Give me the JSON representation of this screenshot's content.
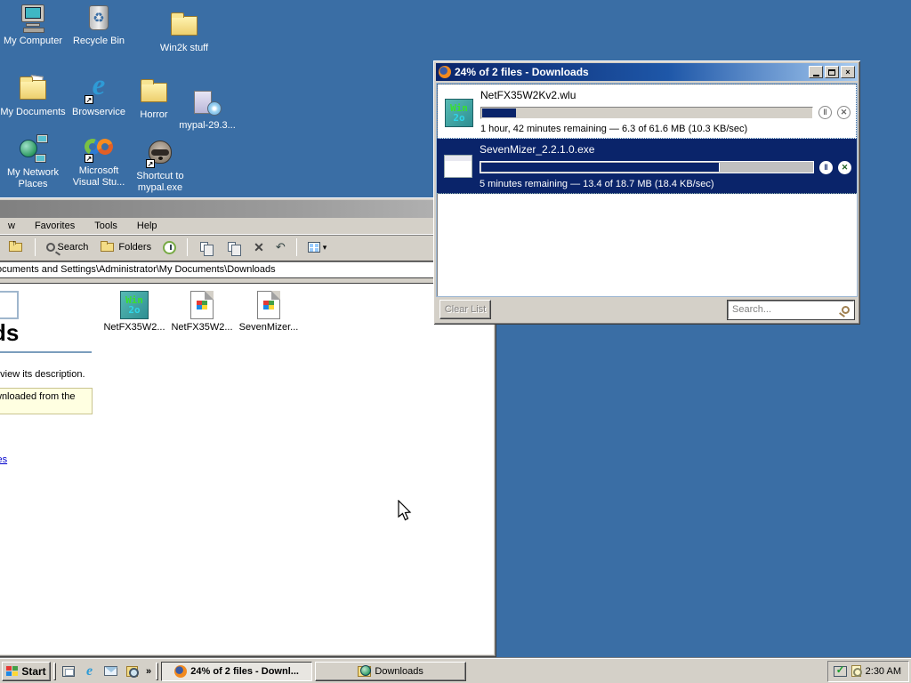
{
  "desktop": {
    "icons": [
      {
        "label": "My Computer"
      },
      {
        "label": "Recycle Bin"
      },
      {
        "label": "Win2k stuff"
      },
      {
        "label": "My Documents"
      },
      {
        "label": "Browservice"
      },
      {
        "label": "Horror"
      },
      {
        "label": "mypal-29.3..."
      },
      {
        "label": "My Network Places"
      },
      {
        "label": "Microsoft Visual Stu..."
      },
      {
        "label": "Shortcut to mypal.exe"
      }
    ]
  },
  "downloads_window": {
    "title": "24% of 2 files - Downloads",
    "items": [
      {
        "name": "NetFX35W2Kv2.wlu",
        "status": "1 hour, 42 minutes remaining — 6.3 of 61.6 MB (10.3 KB/sec)",
        "progress_percent": 10.2
      },
      {
        "name": "SevenMizer_2.2.1.0.exe",
        "status": "5 minutes remaining — 13.4 of 18.7 MB (18.4 KB/sec)",
        "progress_percent": 71.7
      }
    ],
    "clear_list_label": "Clear List",
    "search_placeholder": "Search...",
    "icon1_line1": "Win",
    "icon1_line2": "2o",
    "colors": {
      "selection": "#0A246A",
      "progress_fill": "#0A246A"
    }
  },
  "explorer_window": {
    "menu_items": {
      "m0": "w",
      "m1": "Favorites",
      "m2": "Tools",
      "m3": "Help"
    },
    "toolbar": {
      "search_label": "Search",
      "folders_label": "Folders"
    },
    "address": "ocuments and Settings\\Administrator\\My Documents\\Downloads",
    "files": [
      {
        "label": "NetFX35W2..."
      },
      {
        "label": "NetFX35W2..."
      },
      {
        "label": "SevenMizer..."
      }
    ],
    "panel": {
      "title_fragment": "ds",
      "description_fragment": "o view its description.",
      "note_fragment": "wnloaded from the",
      "link_fragment": "ces"
    }
  },
  "taskbar": {
    "start_label": "Start",
    "overflow_chevron": "»",
    "buttons": [
      {
        "label": "24% of 2 files - Downl...",
        "active": true
      },
      {
        "label": "Downloads",
        "active": false
      }
    ],
    "clock": "2:30 AM"
  }
}
